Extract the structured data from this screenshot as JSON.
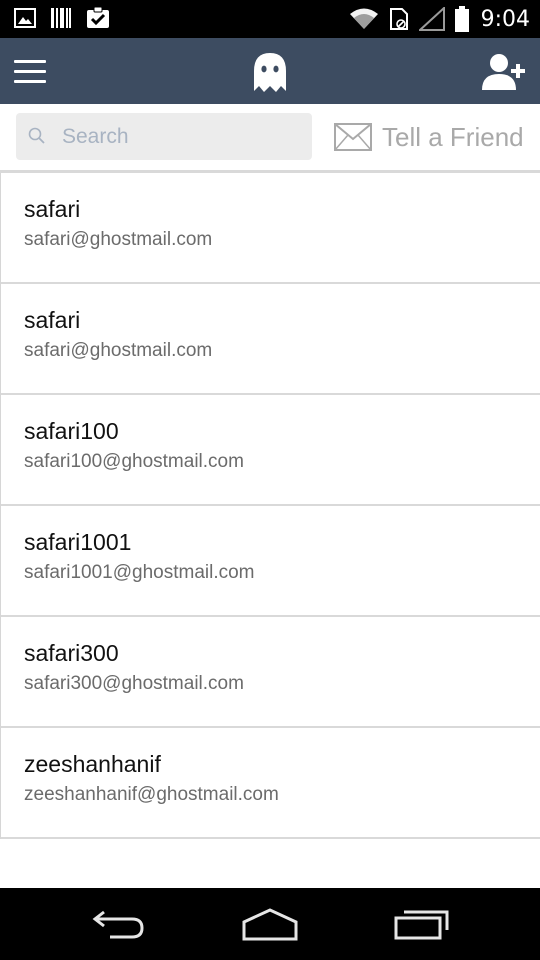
{
  "status_bar": {
    "time": "9:04",
    "icons": [
      "image-icon",
      "barcode-icon",
      "clipboard-check-icon",
      "wifi-icon",
      "sim-icon",
      "signal-icon",
      "battery-icon"
    ]
  },
  "app_bar": {
    "background": "#3d4c61",
    "menu_icon": "hamburger-menu-icon",
    "logo_icon": "ghost-icon",
    "add_user_icon": "add-user-icon"
  },
  "search": {
    "placeholder": "Search",
    "value": ""
  },
  "tell_friend": {
    "label": "Tell a Friend",
    "icon": "envelope-icon"
  },
  "contacts": [
    {
      "name": "safari",
      "email": "safari@ghostmail.com"
    },
    {
      "name": "safari",
      "email": "safari@ghostmail.com"
    },
    {
      "name": "safari100",
      "email": "safari100@ghostmail.com"
    },
    {
      "name": "safari1001",
      "email": "safari1001@ghostmail.com"
    },
    {
      "name": "safari300",
      "email": "safari300@ghostmail.com"
    },
    {
      "name": "zeeshanhanif",
      "email": "zeeshanhanif@ghostmail.com"
    }
  ],
  "nav_bar": {
    "icons": [
      "back-icon",
      "home-icon",
      "recent-apps-icon"
    ]
  }
}
